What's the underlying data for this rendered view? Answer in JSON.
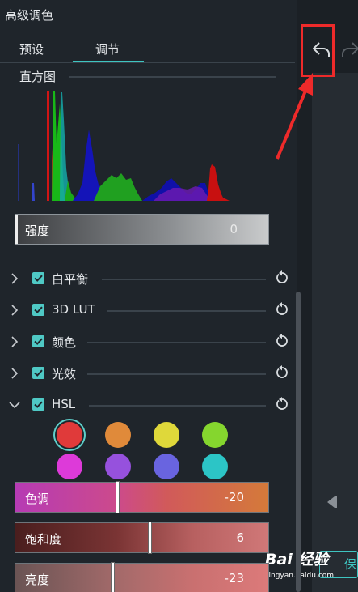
{
  "title": "高级调色",
  "tabs": {
    "preset": "预设",
    "adjust": "调节",
    "active": "adjust"
  },
  "histogram": {
    "label": "直方图"
  },
  "strength": {
    "label": "强度",
    "value": "0"
  },
  "sections": [
    {
      "label": "白平衡",
      "checked": true,
      "expanded": false
    },
    {
      "label": "3D LUT",
      "checked": true,
      "expanded": false
    },
    {
      "label": "颜色",
      "checked": true,
      "expanded": false
    },
    {
      "label": "光效",
      "checked": true,
      "expanded": false
    },
    {
      "label": "HSL",
      "checked": true,
      "expanded": true
    }
  ],
  "hsl": {
    "swatches": [
      {
        "name": "red",
        "color": "#e03a3a",
        "selected": true
      },
      {
        "name": "orange",
        "color": "#e08a3a"
      },
      {
        "name": "yellow",
        "color": "#dfd83a"
      },
      {
        "name": "green",
        "color": "#85d62e"
      },
      {
        "name": "magenta",
        "color": "#dd3ad9"
      },
      {
        "name": "purple",
        "color": "#9651dd"
      },
      {
        "name": "blue",
        "color": "#6964e0"
      },
      {
        "name": "cyan",
        "color": "#2cc5c6"
      }
    ],
    "hue": {
      "label": "色调",
      "value": "-20"
    },
    "saturation": {
      "label": "饱和度",
      "value": "6"
    },
    "lightness": {
      "label": "亮度",
      "value": "-23"
    }
  },
  "watermark": {
    "brand": "Bai 经验",
    "url": "jingyan.baidu.com"
  },
  "save_label": "保",
  "colors": {
    "accent": "#3ec5c1",
    "background": "#1f252b",
    "annotation": "#ee2a2a"
  }
}
